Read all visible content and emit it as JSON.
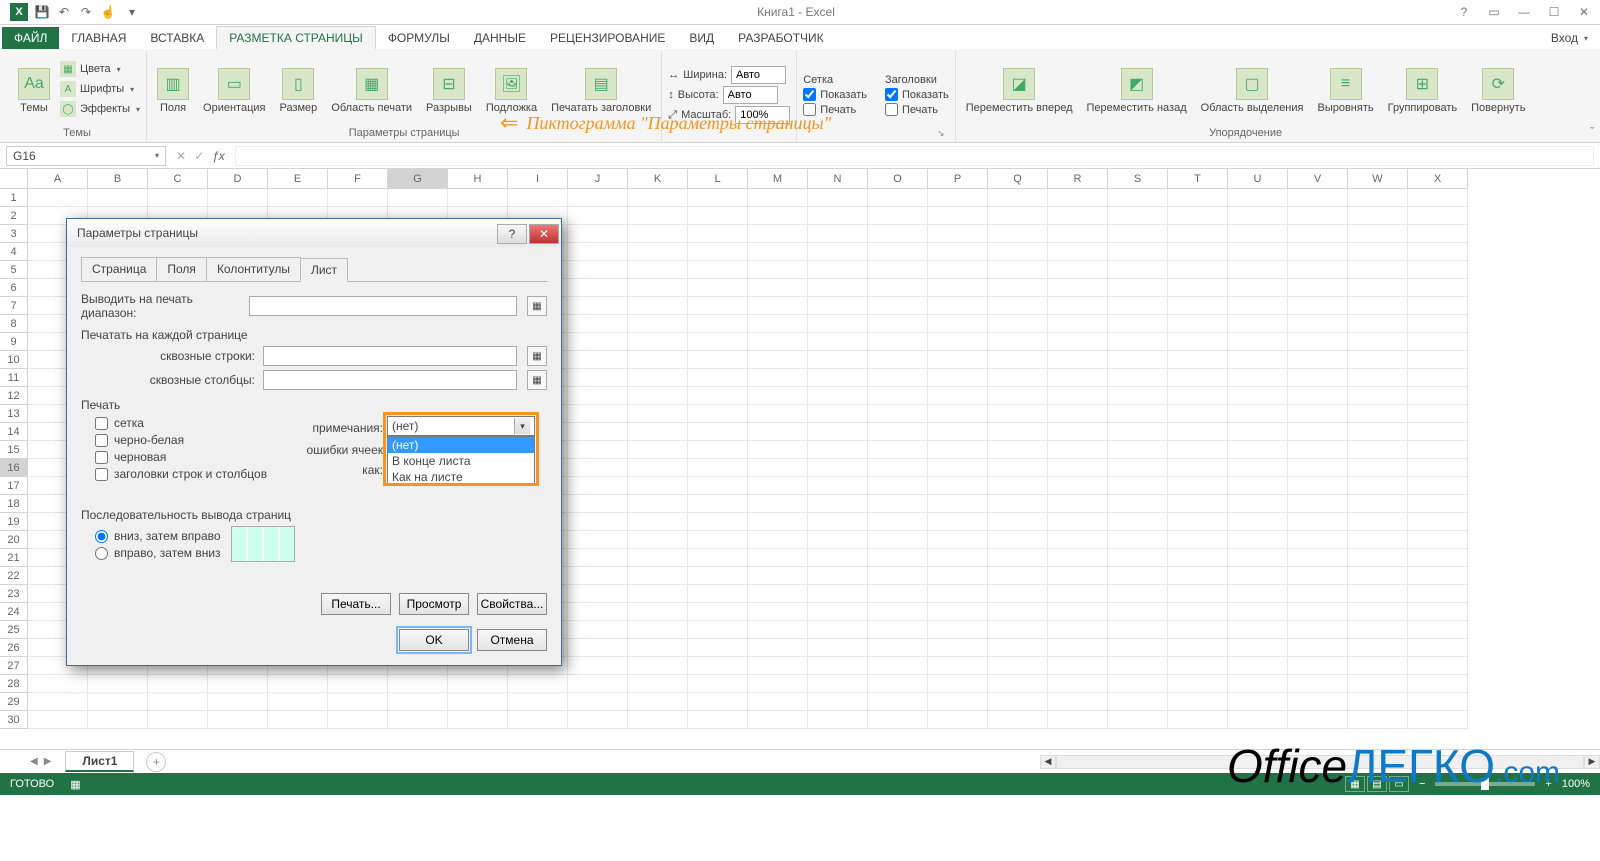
{
  "title": "Книга1 - Excel",
  "login": "Вход",
  "qat_tips": {
    "save": "Сохранить",
    "undo": "Отменить",
    "redo": "Вернуть",
    "touch": "Режим"
  },
  "tabs": {
    "file": "ФАЙЛ",
    "home": "ГЛАВНАЯ",
    "insert": "ВСТАВКА",
    "pagelayout": "РАЗМЕТКА СТРАНИЦЫ",
    "formulas": "ФОРМУЛЫ",
    "data": "ДАННЫЕ",
    "review": "РЕЦЕНЗИРОВАНИЕ",
    "view": "ВИД",
    "dev": "РАЗРАБОТЧИК"
  },
  "ribbon": {
    "themes": {
      "label": "Темы",
      "themes": "Темы",
      "colors": "Цвета",
      "fonts": "Шрифты",
      "effects": "Эффекты"
    },
    "page_setup": {
      "label": "Параметры страницы",
      "margins": "Поля",
      "orientation": "Ориентация",
      "size": "Размер",
      "print_area": "Область печати",
      "breaks": "Разрывы",
      "background": "Подложка",
      "print_titles": "Печатать заголовки"
    },
    "scale": {
      "label": "",
      "width": "Ширина:",
      "height": "Высота:",
      "scale": "Масштаб:",
      "auto": "Авто",
      "pct": "100%"
    },
    "gridlines": {
      "label": "Сетка",
      "show": "Показать",
      "print": "Печать"
    },
    "headings": {
      "label": "Заголовки",
      "show": "Показать",
      "print": "Печать"
    },
    "arrange": {
      "label": "Упорядочение",
      "forward": "Переместить вперед",
      "backward": "Переместить назад",
      "selpane": "Область выделения",
      "align": "Выровнять",
      "group": "Группировать",
      "rotate": "Повернуть"
    }
  },
  "annotation": "Пиктограмма \"Параметры страницы\"",
  "namebox": "G16",
  "columns": [
    "A",
    "B",
    "C",
    "D",
    "E",
    "F",
    "G",
    "H",
    "I",
    "J",
    "K",
    "L",
    "M",
    "N",
    "O",
    "P",
    "Q",
    "R",
    "S",
    "T",
    "U",
    "V",
    "W",
    "X"
  ],
  "sheet_tab": "Лист1",
  "status": "ГОТОВО",
  "zoom": "100%",
  "dialog": {
    "title": "Параметры страницы",
    "tabs": {
      "page": "Страница",
      "margins": "Поля",
      "headerfooter": "Колонтитулы",
      "sheet": "Лист"
    },
    "print_area": "Выводить на печать диапазон:",
    "titles_group": "Печатать на каждой странице",
    "rows": "сквозные строки:",
    "cols": "сквозные столбцы:",
    "print_group": "Печать",
    "grid": "сетка",
    "bw": "черно-белая",
    "draft": "черновая",
    "rowcol": "заголовки строк и столбцов",
    "comments_lbl": "примечания:",
    "errors_lbl": "ошибки ячеек как:",
    "combo_value": "(нет)",
    "combo_options": [
      "(нет)",
      "В конце листа",
      "Как на листе"
    ],
    "order_group": "Последовательность вывода страниц",
    "order1": "вниз, затем вправо",
    "order2": "вправо, затем вниз",
    "btn_print": "Печать...",
    "btn_preview": "Просмотр",
    "btn_props": "Свойства...",
    "ok": "OK",
    "cancel": "Отмена"
  },
  "watermark": {
    "p1": "Office",
    "p2": "ЛЕГКО",
    "p3": ".com"
  }
}
